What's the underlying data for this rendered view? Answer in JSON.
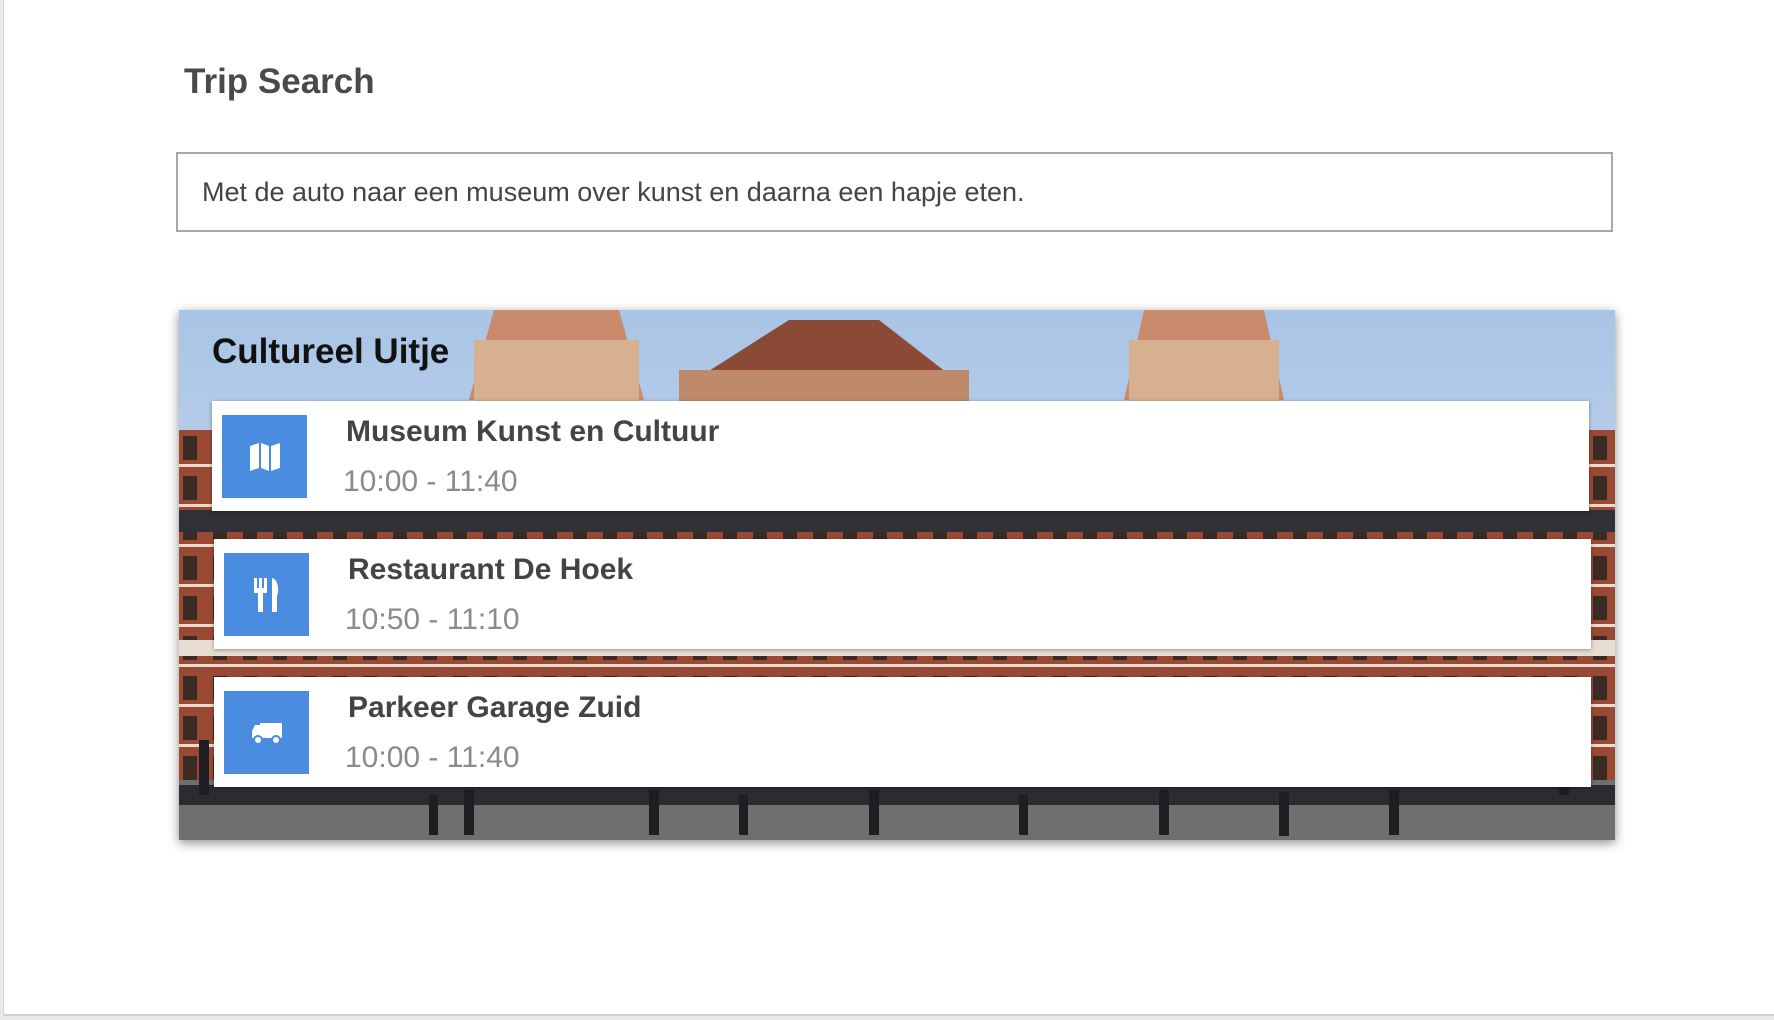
{
  "header": {
    "title": "Trip Search"
  },
  "search": {
    "value": "Met de auto naar een museum over kunst en daarna een hapje eten."
  },
  "trip": {
    "title": "Cultureel Uitje",
    "items": [
      {
        "name": "Museum Kunst en Cultuur",
        "time": "10:00 - 11:40",
        "icon": "map-icon"
      },
      {
        "name": "Restaurant De Hoek",
        "time": "10:50 - 11:10",
        "icon": "restaurant-icon"
      },
      {
        "name": "Parkeer Garage Zuid",
        "time": "10:00 - 11:40",
        "icon": "truck-icon"
      }
    ]
  },
  "colors": {
    "accent": "#4a8ce0",
    "title_text": "#4a4a4a",
    "muted_text": "#8a8a8a"
  }
}
